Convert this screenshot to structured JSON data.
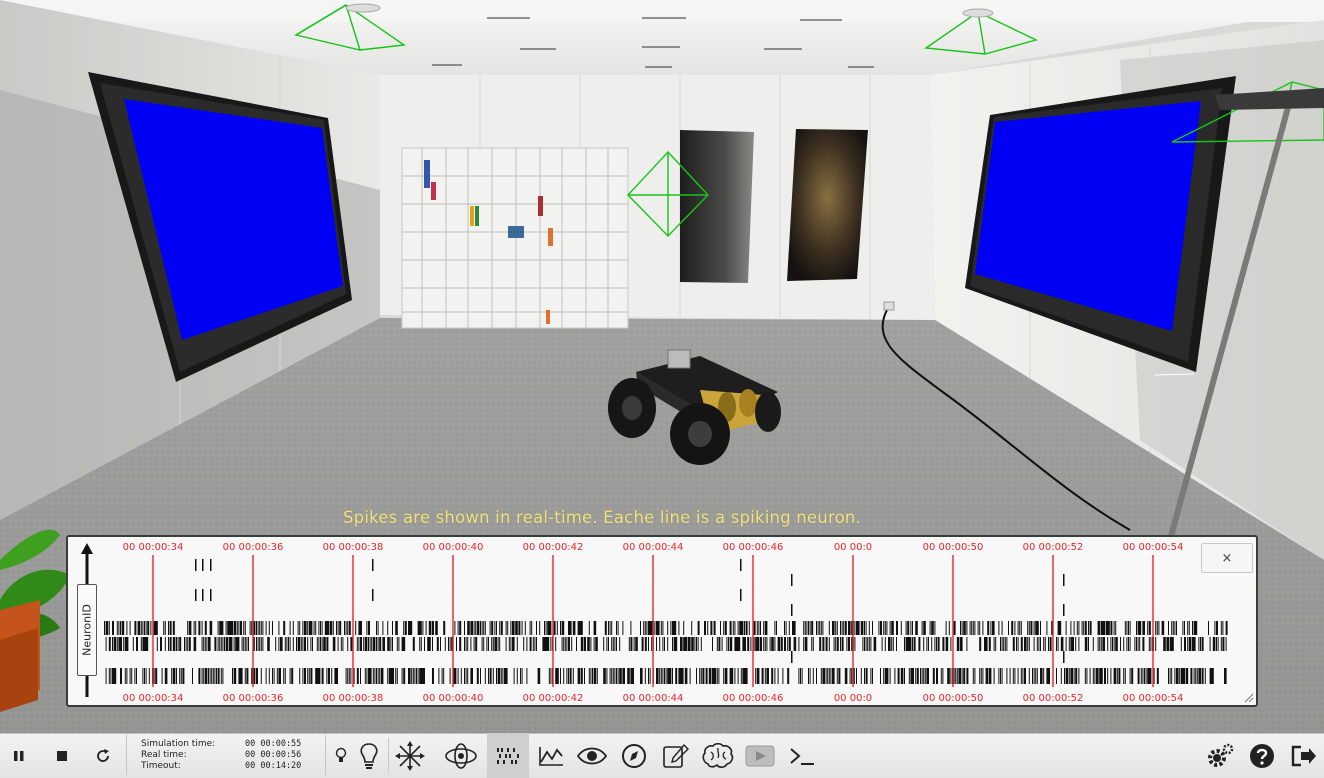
{
  "overlay": {
    "caption": "Spikes are shown in real-time. Eache line is a spiking neuron.",
    "y_axis_label": "NeuronID",
    "close_label": "×",
    "time_labels": [
      "00 00:00:34",
      "00 00:00:36",
      "00 00:00:38",
      "00 00:00:40",
      "00 00:00:42",
      "00 00:00:44",
      "00 00:00:46",
      "00 00:0",
      "00 00:00:50",
      "00 00:00:52",
      "00 00:00:54"
    ],
    "line_color": "#e8262a",
    "spike_color": "#111111"
  },
  "toolbar": {
    "sim_time_label": "Simulation time:",
    "sim_time_value": "00 00:00:55",
    "real_time_label": "Real time:",
    "real_time_value": "00 00:00:56",
    "timeout_label": "Timeout:",
    "timeout_value": "00 00:14:20",
    "left_buttons": [
      "pause-icon",
      "stop-icon",
      "reset-icon"
    ],
    "tools": [
      "light-icon",
      "lightbulb-icon",
      "move-icon",
      "orbit-icon",
      "spike-raster-icon",
      "joint-plot-icon",
      "eye-icon",
      "navigation-icon",
      "editor-icon",
      "brain-icon",
      "video-icon",
      "terminal-icon"
    ],
    "right_buttons": [
      "settings-icon",
      "help-icon",
      "exit-icon"
    ],
    "active_tool": "spike-raster-icon"
  },
  "colors": {
    "screen_blue": "#0000f5",
    "wall": "#ececea",
    "floor": "#9b9b9a"
  }
}
